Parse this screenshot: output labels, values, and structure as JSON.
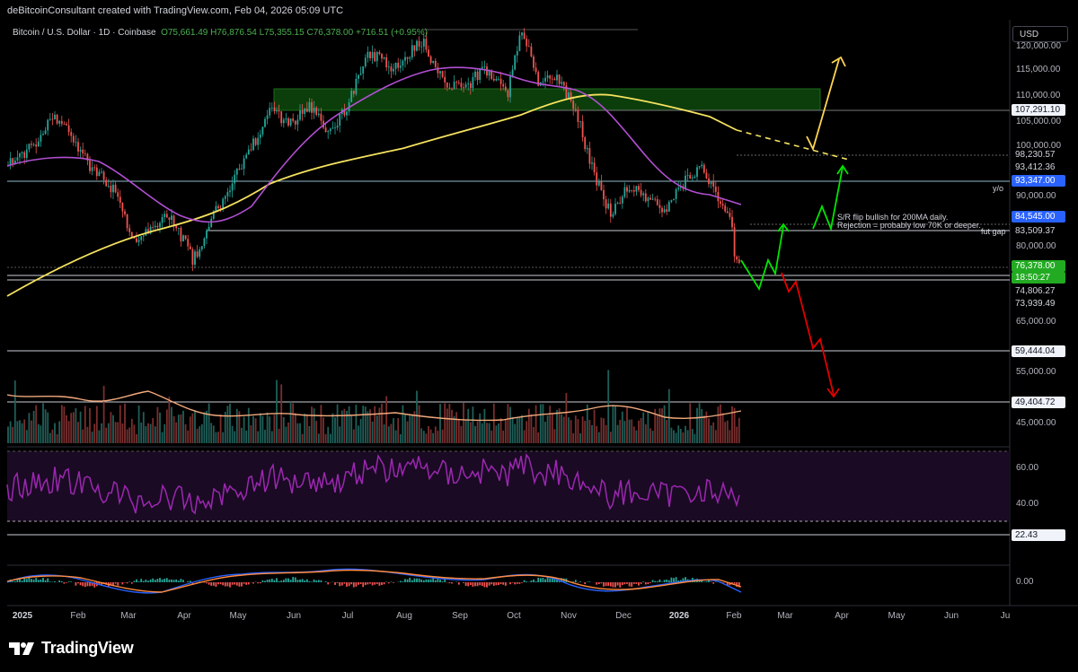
{
  "credit": "deBitcoinConsultant created with TradingView.com, Feb 04, 2026 05:09 UTC",
  "symbol": {
    "name": "Bitcoin / U.S. Dollar · 1D · Coinbase",
    "open": "O75,661.49",
    "high": "H76,876.54",
    "low": "L75,355.15",
    "close": "C76,378.00",
    "change": "+716.51 (+0.95%)"
  },
  "currency_button": "USD",
  "annotations": {
    "sr_line1": "S/R flip bullish for 200MA daily.",
    "sr_line2": "Rejection = probably low 70K or deeper.",
    "yo": "y/o",
    "fut_gap": "fut gap"
  },
  "price_axis": {
    "ticks": [
      "120,000.00",
      "115,000.00",
      "110,000.00",
      "105,000.00",
      "100,000.00",
      "90,000.00",
      "80,000.00",
      "65,000.00",
      "55,000.00",
      "45,000.00"
    ]
  },
  "price_tags": {
    "t107": "107,291.10",
    "t98": "98,230.57",
    "t93b": "93,412.36",
    "t93": "93,347.00",
    "t84": "84,545.00",
    "t83": "83,509.37",
    "t76": "76,378.00",
    "timer": "18:50:27",
    "t74": "74,806.27",
    "t73": "73,939.49",
    "t59": "59,444.04",
    "t49": "49,404.72"
  },
  "rsi_axis": {
    "ticks": [
      "60.00",
      "40.00"
    ],
    "current": "22.43"
  },
  "macd_axis": {
    "ticks": [
      "0.00"
    ]
  },
  "time_axis": [
    "2025",
    "Feb",
    "Mar",
    "Apr",
    "May",
    "Jun",
    "Jul",
    "Aug",
    "Sep",
    "Oct",
    "Nov",
    "Dec",
    "2026",
    "Feb",
    "Mar",
    "Apr",
    "May",
    "Jun",
    "Ju"
  ],
  "brand": "TradingView",
  "colors": {
    "up": "#26a69a",
    "down": "#ef5350",
    "ma200": "#f5e25f",
    "ma50": "#b14fd1",
    "rsi": "#9c27b0",
    "zone": "#0c3d0c",
    "arrow_up": "#00e600",
    "arrow_down": "#e50000",
    "arrow_top": "#ffd54f"
  },
  "chart_data": {
    "type": "candlestick",
    "title": "Bitcoin / U.S. Dollar · 1D · Coinbase",
    "ylim": [
      40000,
      127000
    ],
    "price_scale": "log",
    "x": [
      "2025-01",
      "2025-02",
      "2025-03",
      "2025-04",
      "2025-05",
      "2025-06",
      "2025-07",
      "2025-08",
      "2025-09",
      "2025-10",
      "2025-11",
      "2025-12",
      "2026-01",
      "2026-02"
    ],
    "close_approx": [
      94000,
      97000,
      84000,
      86000,
      104000,
      107000,
      117000,
      113000,
      112000,
      121000,
      91000,
      88000,
      92000,
      76378
    ],
    "levels": [
      107291.1,
      98230.57,
      93412.36,
      93347.0,
      84545.0,
      83509.37,
      76378.0,
      74806.27,
      73939.49,
      59444.04,
      49404.72
    ],
    "zone": [
      107291.1,
      111500
    ],
    "ma200_approx": [
      null,
      73000,
      80000,
      84000,
      87000,
      93000,
      96000,
      99000,
      103000,
      107000,
      110000,
      105000,
      102000,
      98000
    ],
    "rsi_current": 22.43,
    "rsi_levels": [
      30,
      70
    ]
  }
}
